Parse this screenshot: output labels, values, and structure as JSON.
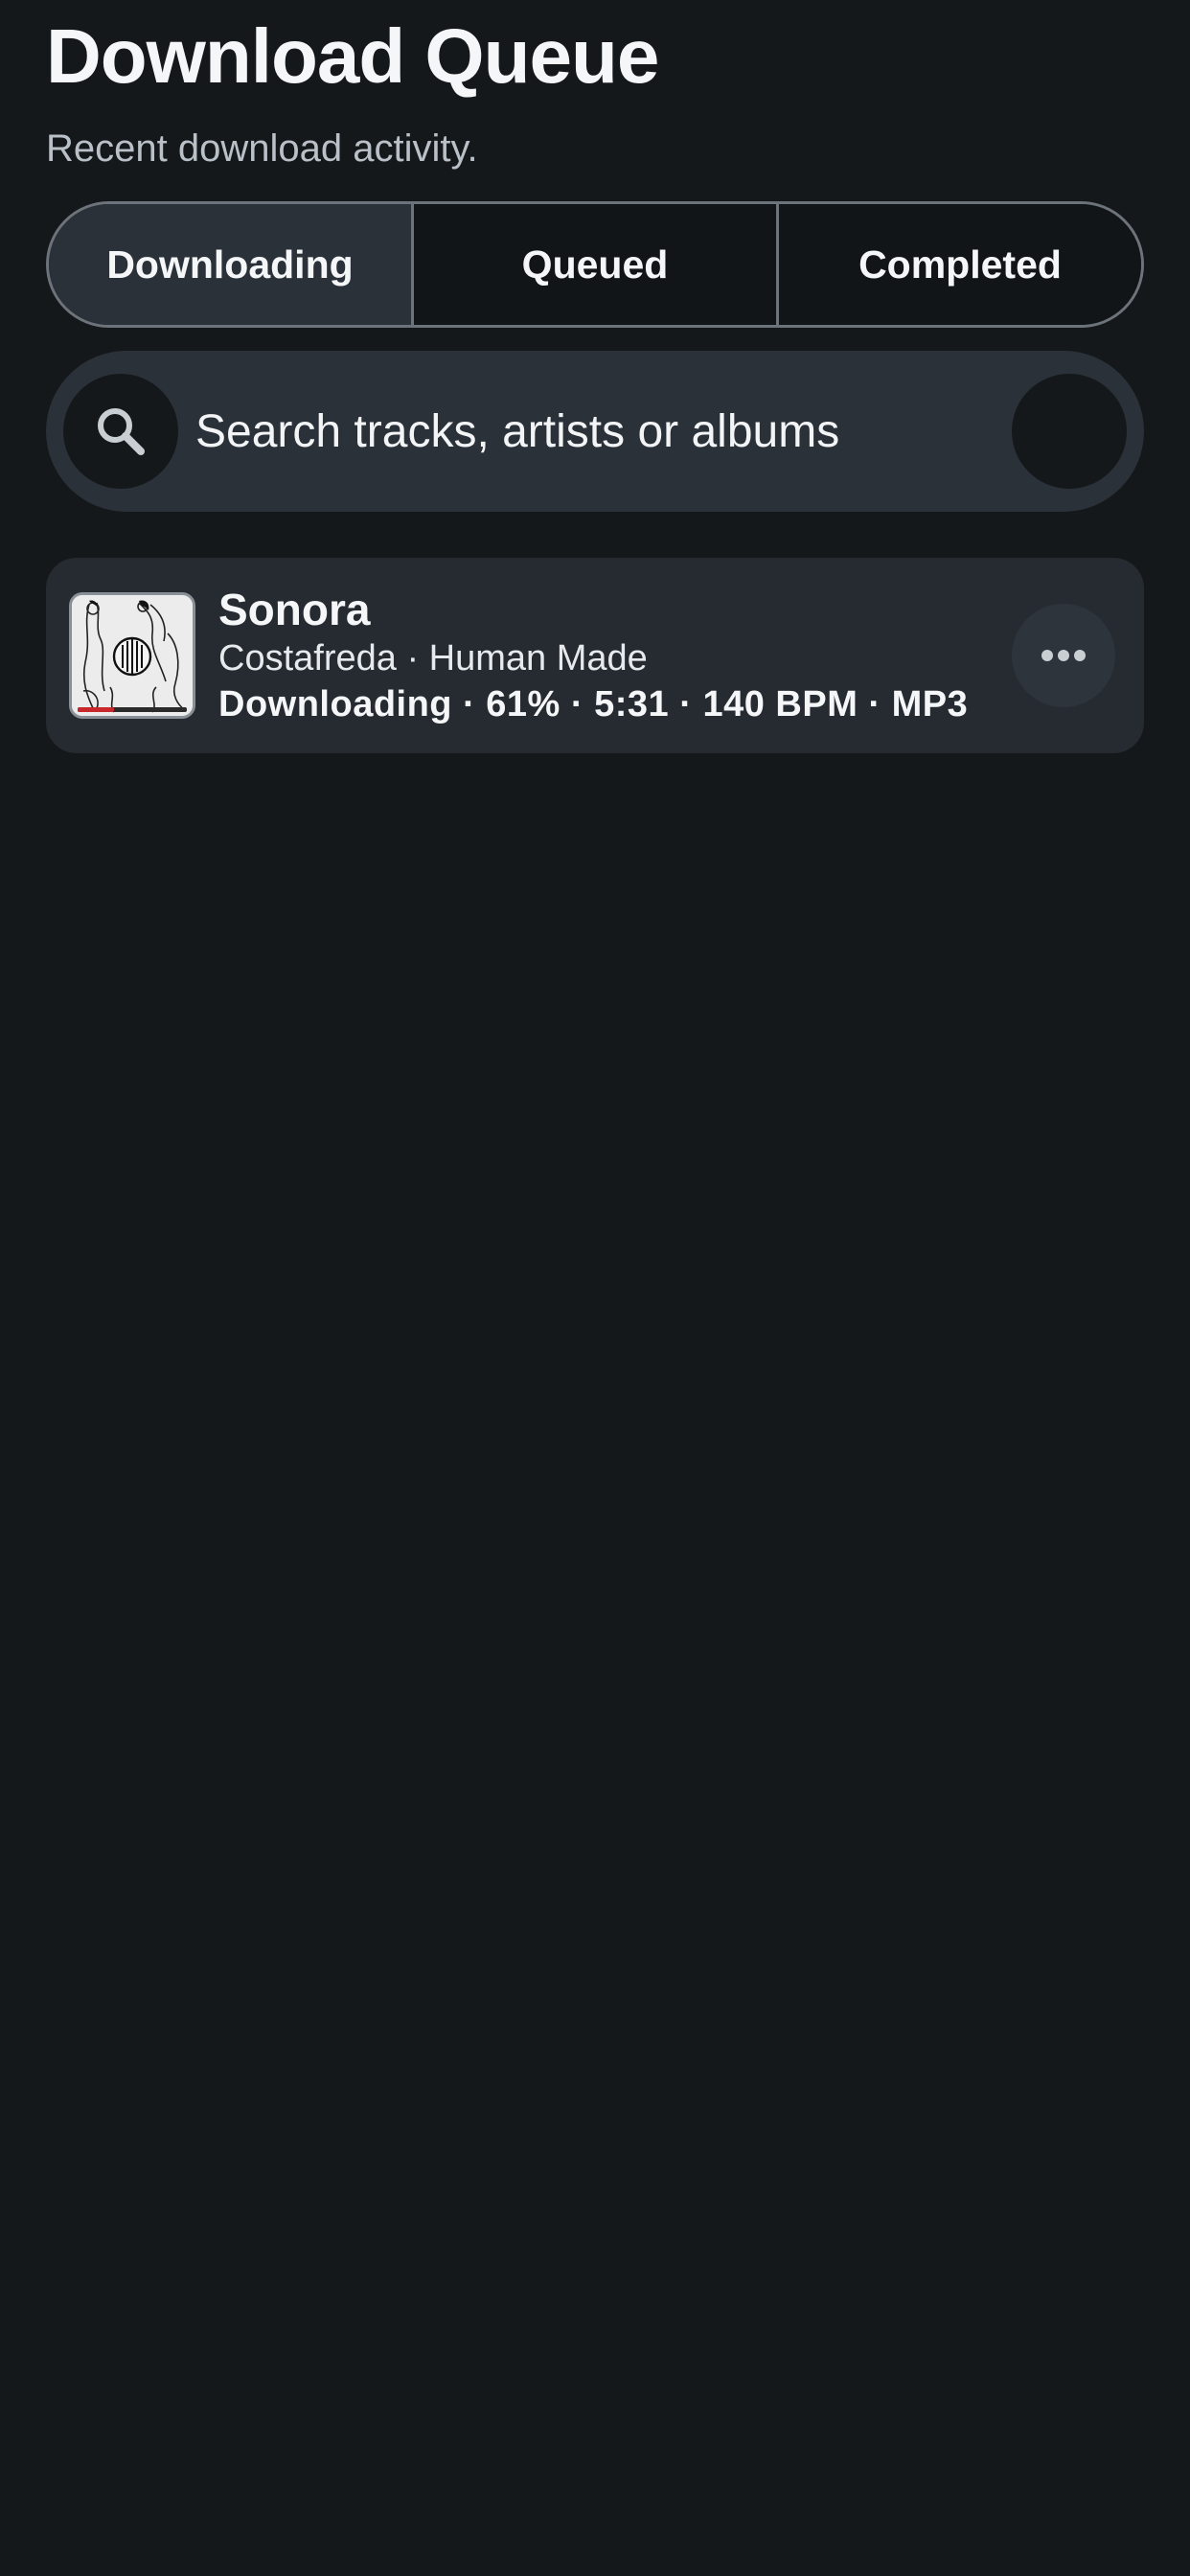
{
  "header": {
    "title": "Download Queue",
    "subtitle": "Recent download activity."
  },
  "tabs": [
    {
      "label": "Downloading",
      "active": true
    },
    {
      "label": "Queued",
      "active": false
    },
    {
      "label": "Completed",
      "active": false
    }
  ],
  "search": {
    "placeholder": "Search tracks, artists or albums",
    "value": "",
    "icon": "search-icon"
  },
  "tracks": [
    {
      "title": "Sonora",
      "subtitle": "Costafreda · Human Made",
      "status": "Downloading · 61% · 5:31 · 140 BPM · MP3",
      "progress_percent": 61,
      "menu_icon": "more-horizontal-icon"
    }
  ],
  "colors": {
    "background": "#15181b",
    "surface": "#262b32",
    "segment_active": "#2b3138",
    "progress": "#c8272b"
  }
}
